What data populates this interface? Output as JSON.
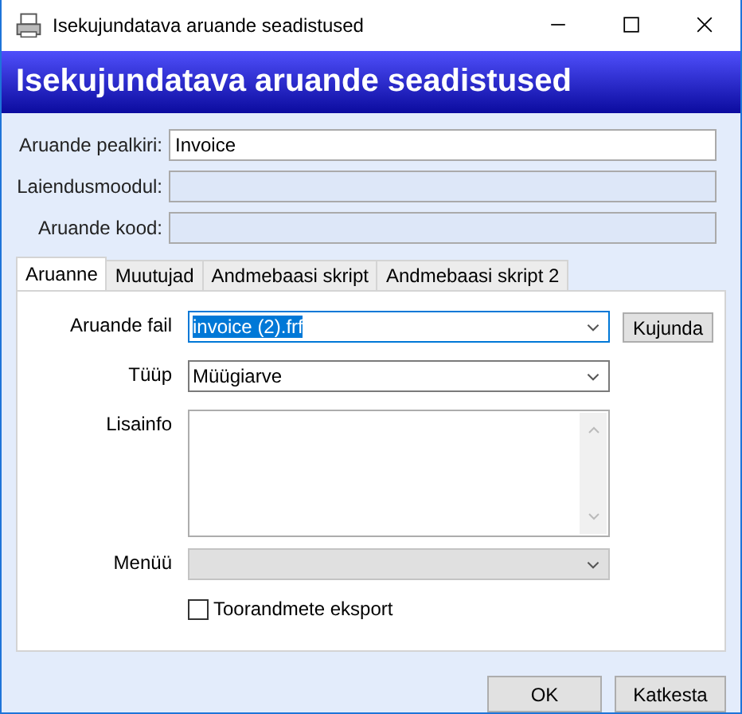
{
  "window": {
    "title": "Isekujundatava aruande seadistused"
  },
  "header": {
    "title": "Isekujundatava aruande seadistused"
  },
  "fields": [
    {
      "label": "Aruande pealkiri:",
      "value": "Invoice",
      "disabled": false
    },
    {
      "label": "Laiendusmoodul:",
      "disabled": true
    },
    {
      "label": "Aruande kood:",
      "disabled": true
    }
  ],
  "tabs": [
    {
      "label": "Aruanne",
      "selected": true
    },
    {
      "label": "Muutujad",
      "selected": false
    },
    {
      "label": "Andmebaasi skript",
      "selected": false
    },
    {
      "label": "Andmebaasi skript 2",
      "selected": false
    }
  ],
  "panel": {
    "rows": [
      {
        "kind": "combo",
        "label": "Aruande fail",
        "value": "invoice (2).frf",
        "highlighted": true,
        "disabled": false,
        "button": "Kujunda"
      },
      {
        "kind": "combo",
        "label": "Tüüp",
        "value": "Müügiarve",
        "highlighted": false,
        "disabled": false
      },
      {
        "kind": "memo",
        "label": "Lisainfo"
      },
      {
        "kind": "combo",
        "label": "Menüü",
        "highlighted": false,
        "disabled": true
      },
      {
        "kind": "check",
        "label": "Toorandmete eksport",
        "checked": false
      }
    ]
  },
  "buttons": [
    "OK",
    "Katkesta"
  ]
}
